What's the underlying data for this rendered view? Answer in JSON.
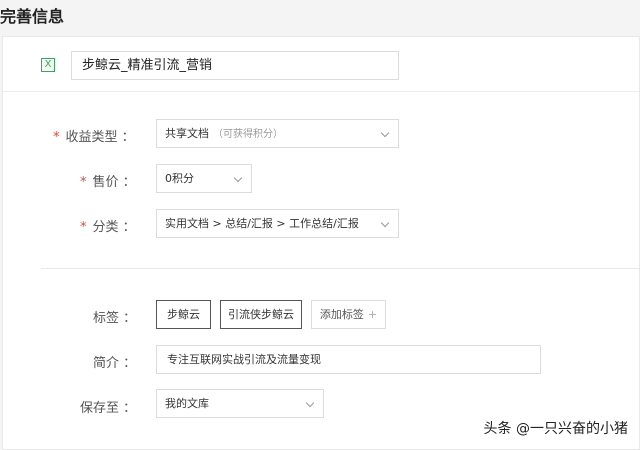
{
  "page_title": "完善信息",
  "file": {
    "icon": "excel-file-icon",
    "icon_glyph": "X",
    "title": "步鲸云_精准引流_营销"
  },
  "fields": {
    "income_type": {
      "label": "收益类型",
      "required_mark": "*",
      "value": "共享文档",
      "hint": "（可获得积分）"
    },
    "price": {
      "label": "售价",
      "required_mark": "*",
      "value": "0积分"
    },
    "category": {
      "label": "分类",
      "required_mark": "*",
      "value": "实用文档 > 总结/汇报 > 工作总结/汇报"
    },
    "tags": {
      "label": "标签",
      "items": [
        "步鲸云",
        "引流侠步鲸云"
      ],
      "add_label": "添加标签",
      "add_icon": "+"
    },
    "summary": {
      "label": "简介",
      "value": "专注互联网实战引流及流量变现"
    },
    "save_to": {
      "label": "保存至",
      "value": "我的文库"
    }
  },
  "colon": "：",
  "watermark": "头条 @一只兴奋的小猪",
  "colors": {
    "required": "#e3463c",
    "excel": "#3aa55b",
    "border": "#dcdcdc"
  }
}
